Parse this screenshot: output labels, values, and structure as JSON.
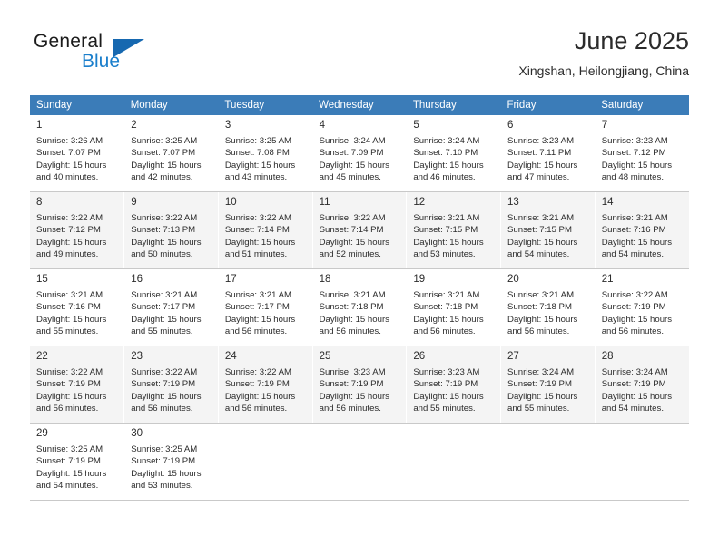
{
  "brand": {
    "name_top": "General",
    "name_bottom": "Blue",
    "triangle_color": "#1668b0",
    "blue_color": "#1b7fcc"
  },
  "header": {
    "title": "June 2025",
    "subtitle": "Xingshan, Heilongjiang, China"
  },
  "theme": {
    "header_bg": "#3b7cb8",
    "header_text": "#ffffff",
    "row_alt_bg": "#f4f4f4",
    "grid_line": "#c9c9c9"
  },
  "weekday_headers": [
    "Sunday",
    "Monday",
    "Tuesday",
    "Wednesday",
    "Thursday",
    "Friday",
    "Saturday"
  ],
  "labels": {
    "sunrise_prefix": "Sunrise:",
    "sunset_prefix": "Sunset:",
    "daylight_prefix": "Daylight:"
  },
  "weeks": [
    [
      {
        "day": "1",
        "sunrise": "Sunrise: 3:26 AM",
        "sunset": "Sunset: 7:07 PM",
        "daylight_1": "Daylight: 15 hours",
        "daylight_2": "and 40 minutes."
      },
      {
        "day": "2",
        "sunrise": "Sunrise: 3:25 AM",
        "sunset": "Sunset: 7:07 PM",
        "daylight_1": "Daylight: 15 hours",
        "daylight_2": "and 42 minutes."
      },
      {
        "day": "3",
        "sunrise": "Sunrise: 3:25 AM",
        "sunset": "Sunset: 7:08 PM",
        "daylight_1": "Daylight: 15 hours",
        "daylight_2": "and 43 minutes."
      },
      {
        "day": "4",
        "sunrise": "Sunrise: 3:24 AM",
        "sunset": "Sunset: 7:09 PM",
        "daylight_1": "Daylight: 15 hours",
        "daylight_2": "and 45 minutes."
      },
      {
        "day": "5",
        "sunrise": "Sunrise: 3:24 AM",
        "sunset": "Sunset: 7:10 PM",
        "daylight_1": "Daylight: 15 hours",
        "daylight_2": "and 46 minutes."
      },
      {
        "day": "6",
        "sunrise": "Sunrise: 3:23 AM",
        "sunset": "Sunset: 7:11 PM",
        "daylight_1": "Daylight: 15 hours",
        "daylight_2": "and 47 minutes."
      },
      {
        "day": "7",
        "sunrise": "Sunrise: 3:23 AM",
        "sunset": "Sunset: 7:12 PM",
        "daylight_1": "Daylight: 15 hours",
        "daylight_2": "and 48 minutes."
      }
    ],
    [
      {
        "day": "8",
        "sunrise": "Sunrise: 3:22 AM",
        "sunset": "Sunset: 7:12 PM",
        "daylight_1": "Daylight: 15 hours",
        "daylight_2": "and 49 minutes."
      },
      {
        "day": "9",
        "sunrise": "Sunrise: 3:22 AM",
        "sunset": "Sunset: 7:13 PM",
        "daylight_1": "Daylight: 15 hours",
        "daylight_2": "and 50 minutes."
      },
      {
        "day": "10",
        "sunrise": "Sunrise: 3:22 AM",
        "sunset": "Sunset: 7:14 PM",
        "daylight_1": "Daylight: 15 hours",
        "daylight_2": "and 51 minutes."
      },
      {
        "day": "11",
        "sunrise": "Sunrise: 3:22 AM",
        "sunset": "Sunset: 7:14 PM",
        "daylight_1": "Daylight: 15 hours",
        "daylight_2": "and 52 minutes."
      },
      {
        "day": "12",
        "sunrise": "Sunrise: 3:21 AM",
        "sunset": "Sunset: 7:15 PM",
        "daylight_1": "Daylight: 15 hours",
        "daylight_2": "and 53 minutes."
      },
      {
        "day": "13",
        "sunrise": "Sunrise: 3:21 AM",
        "sunset": "Sunset: 7:15 PM",
        "daylight_1": "Daylight: 15 hours",
        "daylight_2": "and 54 minutes."
      },
      {
        "day": "14",
        "sunrise": "Sunrise: 3:21 AM",
        "sunset": "Sunset: 7:16 PM",
        "daylight_1": "Daylight: 15 hours",
        "daylight_2": "and 54 minutes."
      }
    ],
    [
      {
        "day": "15",
        "sunrise": "Sunrise: 3:21 AM",
        "sunset": "Sunset: 7:16 PM",
        "daylight_1": "Daylight: 15 hours",
        "daylight_2": "and 55 minutes."
      },
      {
        "day": "16",
        "sunrise": "Sunrise: 3:21 AM",
        "sunset": "Sunset: 7:17 PM",
        "daylight_1": "Daylight: 15 hours",
        "daylight_2": "and 55 minutes."
      },
      {
        "day": "17",
        "sunrise": "Sunrise: 3:21 AM",
        "sunset": "Sunset: 7:17 PM",
        "daylight_1": "Daylight: 15 hours",
        "daylight_2": "and 56 minutes."
      },
      {
        "day": "18",
        "sunrise": "Sunrise: 3:21 AM",
        "sunset": "Sunset: 7:18 PM",
        "daylight_1": "Daylight: 15 hours",
        "daylight_2": "and 56 minutes."
      },
      {
        "day": "19",
        "sunrise": "Sunrise: 3:21 AM",
        "sunset": "Sunset: 7:18 PM",
        "daylight_1": "Daylight: 15 hours",
        "daylight_2": "and 56 minutes."
      },
      {
        "day": "20",
        "sunrise": "Sunrise: 3:21 AM",
        "sunset": "Sunset: 7:18 PM",
        "daylight_1": "Daylight: 15 hours",
        "daylight_2": "and 56 minutes."
      },
      {
        "day": "21",
        "sunrise": "Sunrise: 3:22 AM",
        "sunset": "Sunset: 7:19 PM",
        "daylight_1": "Daylight: 15 hours",
        "daylight_2": "and 56 minutes."
      }
    ],
    [
      {
        "day": "22",
        "sunrise": "Sunrise: 3:22 AM",
        "sunset": "Sunset: 7:19 PM",
        "daylight_1": "Daylight: 15 hours",
        "daylight_2": "and 56 minutes."
      },
      {
        "day": "23",
        "sunrise": "Sunrise: 3:22 AM",
        "sunset": "Sunset: 7:19 PM",
        "daylight_1": "Daylight: 15 hours",
        "daylight_2": "and 56 minutes."
      },
      {
        "day": "24",
        "sunrise": "Sunrise: 3:22 AM",
        "sunset": "Sunset: 7:19 PM",
        "daylight_1": "Daylight: 15 hours",
        "daylight_2": "and 56 minutes."
      },
      {
        "day": "25",
        "sunrise": "Sunrise: 3:23 AM",
        "sunset": "Sunset: 7:19 PM",
        "daylight_1": "Daylight: 15 hours",
        "daylight_2": "and 56 minutes."
      },
      {
        "day": "26",
        "sunrise": "Sunrise: 3:23 AM",
        "sunset": "Sunset: 7:19 PM",
        "daylight_1": "Daylight: 15 hours",
        "daylight_2": "and 55 minutes."
      },
      {
        "day": "27",
        "sunrise": "Sunrise: 3:24 AM",
        "sunset": "Sunset: 7:19 PM",
        "daylight_1": "Daylight: 15 hours",
        "daylight_2": "and 55 minutes."
      },
      {
        "day": "28",
        "sunrise": "Sunrise: 3:24 AM",
        "sunset": "Sunset: 7:19 PM",
        "daylight_1": "Daylight: 15 hours",
        "daylight_2": "and 54 minutes."
      }
    ],
    [
      {
        "day": "29",
        "sunrise": "Sunrise: 3:25 AM",
        "sunset": "Sunset: 7:19 PM",
        "daylight_1": "Daylight: 15 hours",
        "daylight_2": "and 54 minutes."
      },
      {
        "day": "30",
        "sunrise": "Sunrise: 3:25 AM",
        "sunset": "Sunset: 7:19 PM",
        "daylight_1": "Daylight: 15 hours",
        "daylight_2": "and 53 minutes."
      },
      null,
      null,
      null,
      null,
      null
    ]
  ]
}
